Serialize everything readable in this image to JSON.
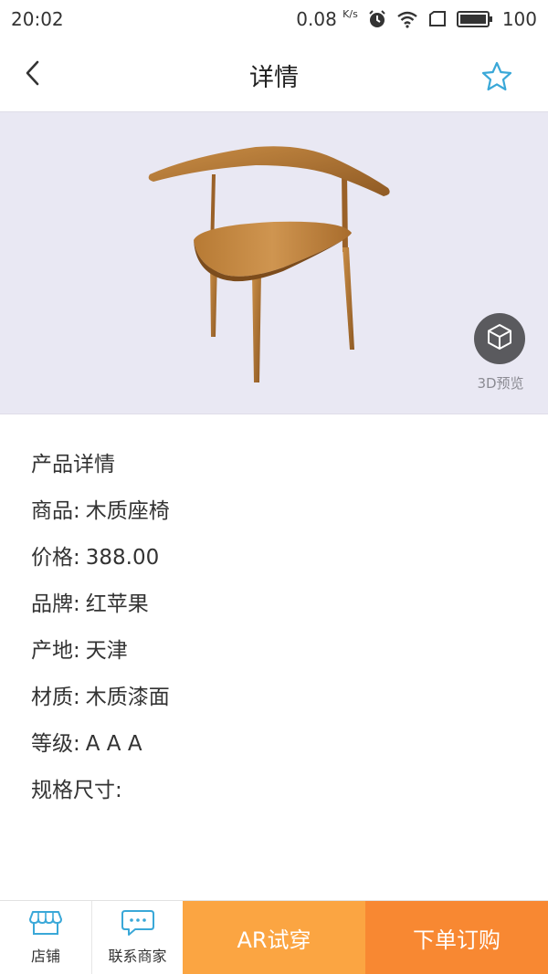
{
  "status_bar": {
    "time": "20:02",
    "network_speed": "0.08",
    "network_unit": "K/s",
    "battery": "100"
  },
  "nav": {
    "title": "详情",
    "back_icon": "chevron-left-icon",
    "favorite_icon": "star-outline-icon",
    "accent_color": "#3aa8d8"
  },
  "preview": {
    "label_3d": "3D预览",
    "background_color": "#e9e8f3"
  },
  "details": {
    "section_title": "产品详情",
    "rows": [
      {
        "key": "商品:",
        "value": "木质座椅"
      },
      {
        "key": "价格:",
        "value": "388.00"
      },
      {
        "key": "品牌:",
        "value": "红苹果"
      },
      {
        "key": "产地:",
        "value": "天津"
      },
      {
        "key": "材质:",
        "value": "木质漆面"
      },
      {
        "key": "等级:",
        "value": "A A A"
      },
      {
        "key": "规格尺寸:",
        "value": ""
      }
    ]
  },
  "bottom_bar": {
    "shop_label": "店铺",
    "contact_label": "联系商家",
    "ar_label": "AR试穿",
    "order_label": "下单订购",
    "ar_color": "#fba542",
    "order_color": "#f88832",
    "icon_color": "#3aa8d8"
  }
}
